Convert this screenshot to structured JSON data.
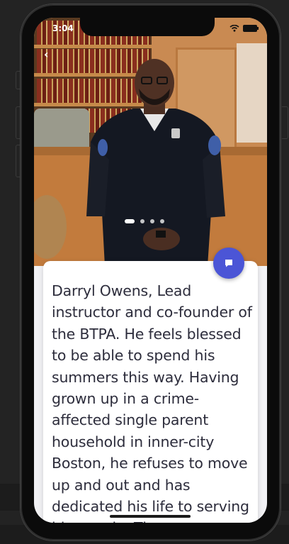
{
  "status_bar": {
    "time": "3:04"
  },
  "header": {
    "back_label": "‹"
  },
  "carousel": {
    "slide_count": 4,
    "active_index": 0
  },
  "card": {
    "description": "Darryl Owens, Lead instructor and co-founder of the BTPA. He feels blessed to be able to spend his summers this way. Having grown up in a crime-affected single parent household in inner-city Boston, he refuses to move up and out and has dedicated his life to serving his people. The"
  },
  "fab": {
    "icon": "chat-icon"
  },
  "colors": {
    "accent": "#4b55d6",
    "text": "#2d2d3c"
  }
}
